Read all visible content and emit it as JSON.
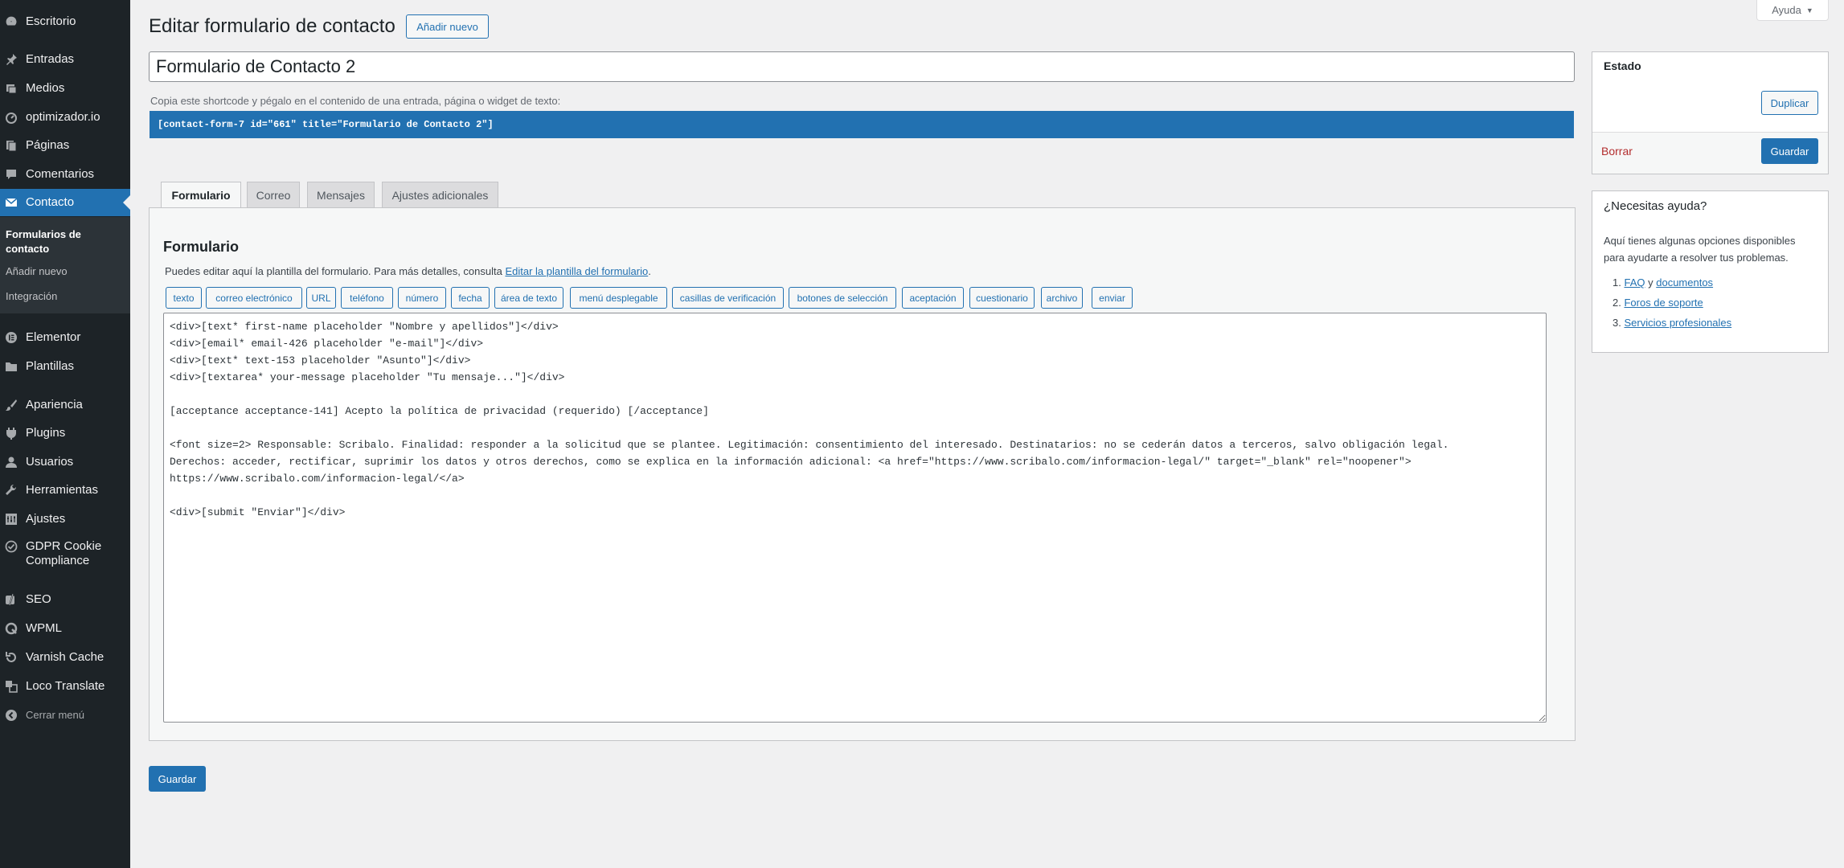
{
  "sidebar": {
    "items": [
      {
        "label": "Escritorio",
        "icon": "dashboard-icon"
      },
      {
        "label": "Entradas",
        "icon": "pin-icon"
      },
      {
        "label": "Medios",
        "icon": "media-icon"
      },
      {
        "label": "optimizador.io",
        "icon": "gauge-icon"
      },
      {
        "label": "Páginas",
        "icon": "pages-icon"
      },
      {
        "label": "Comentarios",
        "icon": "comment-icon"
      },
      {
        "label": "Contacto",
        "icon": "mail-icon"
      },
      {
        "label": "Elementor",
        "icon": "elementor-icon"
      },
      {
        "label": "Plantillas",
        "icon": "folder-icon"
      },
      {
        "label": "Apariencia",
        "icon": "brush-icon"
      },
      {
        "label": "Plugins",
        "icon": "plugin-icon"
      },
      {
        "label": "Usuarios",
        "icon": "user-icon"
      },
      {
        "label": "Herramientas",
        "icon": "wrench-icon"
      },
      {
        "label": "Ajustes",
        "icon": "settings-icon"
      },
      {
        "label": "GDPR Cookie Compliance",
        "icon": "check-badge-icon"
      },
      {
        "label": "SEO",
        "icon": "yoast-icon"
      },
      {
        "label": "WPML",
        "icon": "wpml-icon"
      },
      {
        "label": "Varnish Cache",
        "icon": "cache-icon"
      },
      {
        "label": "Loco Translate",
        "icon": "translate-icon"
      }
    ],
    "submenu": [
      "Formularios de contacto",
      "Añadir nuevo",
      "Integración"
    ],
    "collapse_label": "Cerrar menú"
  },
  "header": {
    "title": "Editar formulario de contacto",
    "add_new_label": "Añadir nuevo",
    "help_label": "Ayuda"
  },
  "form": {
    "title_value": "Formulario de Contacto 2",
    "shortcode_label": "Copia este shortcode y pégalo en el contenido de una entrada, página o widget de texto:",
    "shortcode": "[contact-form-7 id=\"661\" title=\"Formulario de Contacto 2\"]"
  },
  "tabs": [
    "Formulario",
    "Correo",
    "Mensajes",
    "Ajustes adicionales"
  ],
  "panel": {
    "title": "Formulario",
    "desc_prefix": "Puedes editar aquí la plantilla del formulario. Para más detalles, consulta ",
    "desc_link": "Editar la plantilla del formulario",
    "desc_suffix": ".",
    "tag_buttons": [
      "texto",
      "correo electrónico",
      "URL",
      "teléfono",
      "número",
      "fecha",
      "área de texto",
      "menú desplegable",
      "casillas de verificación",
      "botones de selección",
      "aceptación",
      "cuestionario",
      "archivo",
      "enviar"
    ],
    "editor_content": "<div>[text* first-name placeholder \"Nombre y apellidos\"]</div>\n<div>[email* email-426 placeholder \"e-mail\"]</div>\n<div>[text* text-153 placeholder \"Asunto\"]</div>\n<div>[textarea* your-message placeholder \"Tu mensaje...\"]</div>\n\n[acceptance acceptance-141] Acepto la política de privacidad (requerido) [/acceptance]\n\n<font size=2> Responsable: Scribalo. Finalidad: responder a la solicitud que se plantee. Legitimación: consentimiento del interesado. Destinatarios: no se cederán datos a terceros, salvo obligación legal.\nDerechos: acceder, rectificar, suprimir los datos y otros derechos, como se explica en la información adicional: <a href=\"https://www.scribalo.com/informacion-legal/\" target=\"_blank\" rel=\"noopener\">\nhttps://www.scribalo.com/informacion-legal/</a>\n\n<div>[submit \"Enviar\"]</div>"
  },
  "save_label": "Guardar",
  "status_box": {
    "title": "Estado",
    "duplicate_label": "Duplicar",
    "delete_label": "Borrar",
    "save_label": "Guardar"
  },
  "help_box": {
    "title": "¿Necesitas ayuda?",
    "desc": "Aquí tienes algunas opciones disponibles para ayudarte a resolver tus problemas.",
    "links": {
      "faq": "FAQ",
      "and": "y",
      "docs": "documentos",
      "forums": "Foros de soporte",
      "services": "Servicios profesionales"
    }
  },
  "colors": {
    "sidebar_bg": "#1d2327",
    "accent": "#2271b1",
    "delete": "#b32d2e"
  }
}
